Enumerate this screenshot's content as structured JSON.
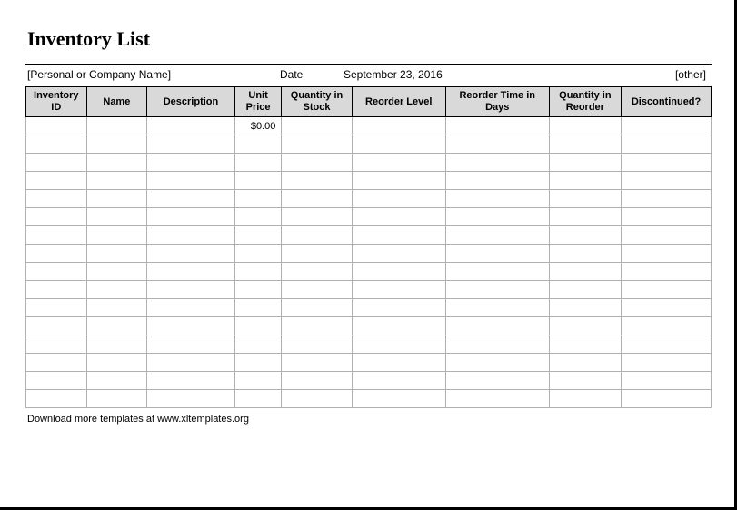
{
  "title": "Inventory List",
  "info": {
    "company_placeholder": "[Personal or Company Name]",
    "date_label": "Date",
    "date_value": "September 23, 2016",
    "other_placeholder": "[other]"
  },
  "columns": {
    "inventory_id": "Inventory ID",
    "name": "Name",
    "description": "Description",
    "unit_price": "Unit Price",
    "qty_stock": "Quantity in Stock",
    "reorder_level": "Reorder Level",
    "reorder_time": "Reorder Time in Days",
    "qty_reorder": "Quantity in Reorder",
    "discontinued": "Discontinued?"
  },
  "rows": [
    {
      "inventory_id": "",
      "name": "",
      "description": "",
      "unit_price": "$0.00",
      "qty_stock": "",
      "reorder_level": "",
      "reorder_time": "",
      "qty_reorder": "",
      "discontinued": ""
    },
    {
      "inventory_id": "",
      "name": "",
      "description": "",
      "unit_price": "",
      "qty_stock": "",
      "reorder_level": "",
      "reorder_time": "",
      "qty_reorder": "",
      "discontinued": ""
    },
    {
      "inventory_id": "",
      "name": "",
      "description": "",
      "unit_price": "",
      "qty_stock": "",
      "reorder_level": "",
      "reorder_time": "",
      "qty_reorder": "",
      "discontinued": ""
    },
    {
      "inventory_id": "",
      "name": "",
      "description": "",
      "unit_price": "",
      "qty_stock": "",
      "reorder_level": "",
      "reorder_time": "",
      "qty_reorder": "",
      "discontinued": ""
    },
    {
      "inventory_id": "",
      "name": "",
      "description": "",
      "unit_price": "",
      "qty_stock": "",
      "reorder_level": "",
      "reorder_time": "",
      "qty_reorder": "",
      "discontinued": ""
    },
    {
      "inventory_id": "",
      "name": "",
      "description": "",
      "unit_price": "",
      "qty_stock": "",
      "reorder_level": "",
      "reorder_time": "",
      "qty_reorder": "",
      "discontinued": ""
    },
    {
      "inventory_id": "",
      "name": "",
      "description": "",
      "unit_price": "",
      "qty_stock": "",
      "reorder_level": "",
      "reorder_time": "",
      "qty_reorder": "",
      "discontinued": ""
    },
    {
      "inventory_id": "",
      "name": "",
      "description": "",
      "unit_price": "",
      "qty_stock": "",
      "reorder_level": "",
      "reorder_time": "",
      "qty_reorder": "",
      "discontinued": ""
    },
    {
      "inventory_id": "",
      "name": "",
      "description": "",
      "unit_price": "",
      "qty_stock": "",
      "reorder_level": "",
      "reorder_time": "",
      "qty_reorder": "",
      "discontinued": ""
    },
    {
      "inventory_id": "",
      "name": "",
      "description": "",
      "unit_price": "",
      "qty_stock": "",
      "reorder_level": "",
      "reorder_time": "",
      "qty_reorder": "",
      "discontinued": ""
    },
    {
      "inventory_id": "",
      "name": "",
      "description": "",
      "unit_price": "",
      "qty_stock": "",
      "reorder_level": "",
      "reorder_time": "",
      "qty_reorder": "",
      "discontinued": ""
    },
    {
      "inventory_id": "",
      "name": "",
      "description": "",
      "unit_price": "",
      "qty_stock": "",
      "reorder_level": "",
      "reorder_time": "",
      "qty_reorder": "",
      "discontinued": ""
    },
    {
      "inventory_id": "",
      "name": "",
      "description": "",
      "unit_price": "",
      "qty_stock": "",
      "reorder_level": "",
      "reorder_time": "",
      "qty_reorder": "",
      "discontinued": ""
    },
    {
      "inventory_id": "",
      "name": "",
      "description": "",
      "unit_price": "",
      "qty_stock": "",
      "reorder_level": "",
      "reorder_time": "",
      "qty_reorder": "",
      "discontinued": ""
    },
    {
      "inventory_id": "",
      "name": "",
      "description": "",
      "unit_price": "",
      "qty_stock": "",
      "reorder_level": "",
      "reorder_time": "",
      "qty_reorder": "",
      "discontinued": ""
    },
    {
      "inventory_id": "",
      "name": "",
      "description": "",
      "unit_price": "",
      "qty_stock": "",
      "reorder_level": "",
      "reorder_time": "",
      "qty_reorder": "",
      "discontinued": ""
    }
  ],
  "footer": {
    "note": "Download more templates at www.xltemplates.org"
  }
}
